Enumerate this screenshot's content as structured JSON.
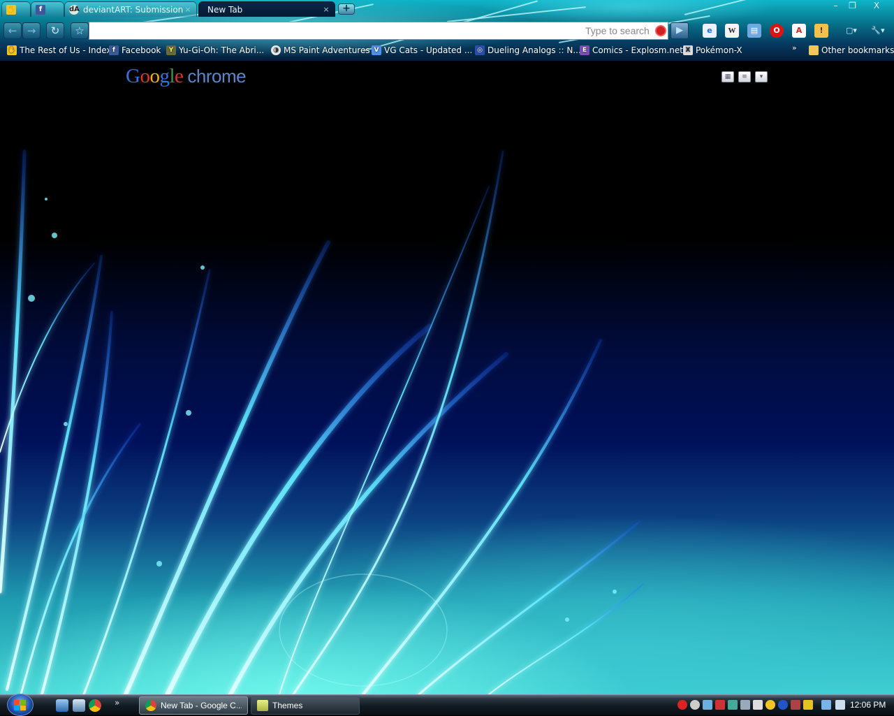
{
  "browser": {
    "tabs": [
      {
        "title": "",
        "icon": "cursor-hand-icon",
        "active": false
      },
      {
        "title": "",
        "icon": "facebook-icon",
        "active": false
      },
      {
        "title": "deviantART: Submission",
        "icon": "deviantart-icon",
        "active": false
      },
      {
        "title": "New Tab",
        "icon": "",
        "active": true
      }
    ],
    "new_tab_symbol": "+",
    "window_controls": {
      "minimize": "–",
      "restore": "❐",
      "close": "X"
    },
    "toolbar": {
      "back": "←",
      "forward": "→",
      "reload": "↻",
      "star": "☆",
      "address_value": "",
      "search_placeholder": "Type to search",
      "go_symbol": "▶",
      "extensions": [
        "ie-tab-icon",
        "wikipedia-icon",
        "screenshot-icon",
        "opera-icon",
        "translate-icon",
        "flashlight-icon"
      ],
      "page_menu_symbol": "▢▾",
      "wrench_menu_symbol": "🔧▾"
    },
    "bookmarks": [
      {
        "label": "The Rest of Us - Index",
        "icon": "cursor-hand-icon"
      },
      {
        "label": "Facebook",
        "icon": "facebook-icon"
      },
      {
        "label": "Yu-Gi-Oh: The Abri...",
        "icon": "yugioh-icon"
      },
      {
        "label": "MS Paint Adventures",
        "icon": "mspa-icon"
      },
      {
        "label": "VG Cats - Updated ...",
        "icon": "vgcats-icon"
      },
      {
        "label": "Dueling Analogs :: N...",
        "icon": "controller-icon"
      },
      {
        "label": "Comics - Explosm.net",
        "icon": "explosm-icon"
      },
      {
        "label": "Pokémon-X",
        "icon": "pokemon-x-icon"
      }
    ],
    "bookmarks_overflow": "»",
    "other_bookmarks": "Other bookmarks"
  },
  "page": {
    "brand_google": [
      "G",
      "o",
      "o",
      "g",
      "l",
      "e"
    ],
    "brand_chrome": "chrome",
    "view_buttons": [
      "grid-view-icon",
      "list-view-icon",
      "options-menu-icon"
    ]
  },
  "taskbar": {
    "start_icon": "windows-start-icon",
    "quick_launch": [
      "show-desktop-icon",
      "window-switch-icon",
      "chrome-icon"
    ],
    "quick_overflow": "»",
    "tasks": [
      {
        "label": "New Tab - Google C...",
        "icon": "chrome-icon",
        "active": true
      },
      {
        "label": "Themes",
        "icon": "notepad-icon",
        "active": false
      }
    ],
    "tray_icons": [
      "tray-red-x-icon",
      "tray-steam-icon",
      "tray-people-icon",
      "tray-dagger-icon",
      "tray-display-icon",
      "tray-usb-icon",
      "tray-tools-icon",
      "tray-tool2-icon",
      "tray-smiley-icon",
      "tray-ring-icon",
      "tray-dragon-icon",
      "tray-shield-icon",
      "tray-network-icon",
      "tray-volume-icon"
    ],
    "clock": "12:06 PM"
  }
}
